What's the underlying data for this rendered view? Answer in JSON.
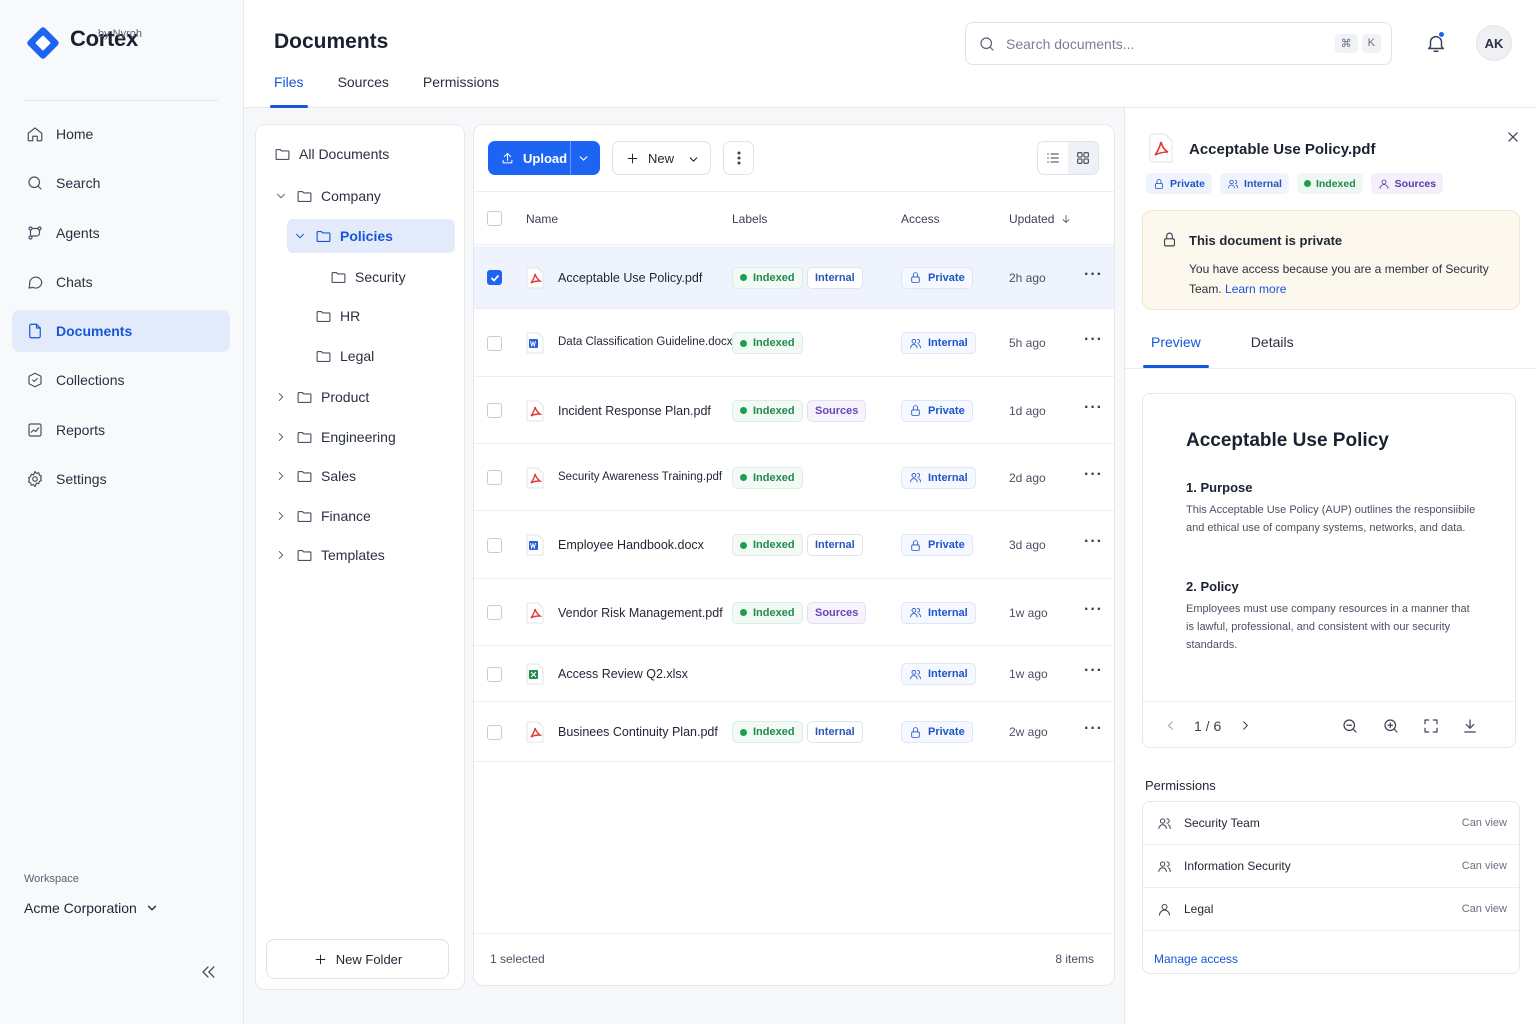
{
  "brand": {
    "name": "Cortex",
    "sub": "by Nyroh",
    "color": "#1d64f2"
  },
  "nav": [
    {
      "label": "Home",
      "icon": "home-icon"
    },
    {
      "label": "Search",
      "icon": "search-icon"
    },
    {
      "label": "Agents",
      "icon": "agents-icon"
    },
    {
      "label": "Chats",
      "icon": "chat-icon"
    },
    {
      "label": "Documents",
      "icon": "document-icon",
      "active": true
    },
    {
      "label": "Collections",
      "icon": "collections-icon"
    },
    {
      "label": "Reports",
      "icon": "reports-icon"
    },
    {
      "label": "Settings",
      "icon": "gear-icon"
    }
  ],
  "workspace": {
    "label": "Workspace",
    "name": "Acme Corporation"
  },
  "header": {
    "title": "Documents",
    "tabs": [
      "Files",
      "Sources",
      "Permissions"
    ],
    "active_tab": "Files",
    "search_placeholder": "Search documents...",
    "shortcut": [
      "⌘",
      "K"
    ],
    "avatar": "AK"
  },
  "tree": {
    "root": "All Documents",
    "items": [
      "Company",
      "Policies",
      "Security",
      "HR",
      "Legal",
      "Product",
      "Engineering",
      "Sales",
      "Finance",
      "Templates"
    ],
    "selected": "Policies",
    "new_folder": "New Folder"
  },
  "toolbar": {
    "upload": "Upload",
    "new": "New"
  },
  "table": {
    "columns": {
      "name": "Name",
      "labels": "Labels",
      "access": "Access",
      "updated": "Updated"
    },
    "rows": [
      {
        "name": "Acceptable Use Policy.pdf",
        "type": "pdf",
        "labels": [
          "Indexed",
          "Internal"
        ],
        "access": "Private",
        "updated": "2h ago",
        "selected": true
      },
      {
        "name": "Data Classification Guideline.docx",
        "type": "docx",
        "labels": [
          "Indexed"
        ],
        "access": "Internal",
        "updated": "5h ago"
      },
      {
        "name": "Incident Response Plan.pdf",
        "type": "pdf",
        "labels": [
          "Indexed",
          "Sources"
        ],
        "access": "Private",
        "updated": "1d ago"
      },
      {
        "name": "Security Awareness Training.pdf",
        "type": "pdf",
        "labels": [
          "Indexed"
        ],
        "access": "Internal",
        "updated": "2d ago"
      },
      {
        "name": "Employee Handbook.docx",
        "type": "docx",
        "labels": [
          "Indexed",
          "Internal"
        ],
        "access": "Private",
        "updated": "3d ago"
      },
      {
        "name": "Vendor Risk Management.pdf",
        "type": "pdf",
        "labels": [
          "Indexed",
          "Sources"
        ],
        "access": "Internal",
        "updated": "1w ago"
      },
      {
        "name": "Access Review Q2.xlsx",
        "type": "xlsx",
        "labels": [],
        "access": "Internal",
        "updated": "1w ago"
      },
      {
        "name": "Businees Continuity Plan.pdf",
        "type": "pdf",
        "labels": [
          "Indexed",
          "Internal"
        ],
        "access": "Private",
        "updated": "2w ago"
      }
    ],
    "footer_selected": "1 selected",
    "footer_count": "8 items"
  },
  "detail": {
    "title": "Acceptable Use Policy.pdf",
    "tags": [
      "Private",
      "Internal",
      "Indexed",
      "Sources"
    ],
    "notice_title": "This document is private",
    "notice_body": "You have access because you are a member of Security Team.",
    "notice_link": "Learn more",
    "tabs": [
      "Preview",
      "Details"
    ],
    "preview": {
      "heading": "Acceptable Use Policy",
      "s1_title": "1. Purpose",
      "s1_body": "This Acceptable Use Policy (AUP) outlines the responsiibile and ethical use of company systems, networks, and data.",
      "s2_title": "2. Policy",
      "s2_body": "Employees must use company resources in a manner that is lawful, professional, and consistent with our security standards.",
      "page": "1 / 6"
    },
    "permissions_title": "Permissions",
    "permissions": [
      {
        "name": "Security Team",
        "role": "Can view",
        "icon": "group-icon"
      },
      {
        "name": "Information Security",
        "role": "Can view",
        "icon": "group-icon"
      },
      {
        "name": "Legal",
        "role": "Can view",
        "icon": "user-icon"
      }
    ],
    "manage": "Manage access"
  }
}
